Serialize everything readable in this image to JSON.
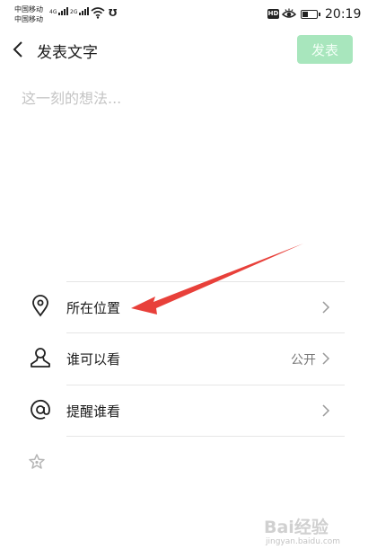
{
  "status_bar": {
    "carrier1": "中国移动",
    "carrier2": "中国移动",
    "sig1_label": "4G",
    "sig2_label": "2G",
    "hd": "HD",
    "time": "20:19",
    "battery_level": 0.45
  },
  "header": {
    "title": "发表文字",
    "publish_label": "发表",
    "publish_color": "#a8e6bd"
  },
  "composer": {
    "placeholder": "这一刻的想法..."
  },
  "options": [
    {
      "label": "所在位置",
      "value": "",
      "icon": "location-pin-icon"
    },
    {
      "label": "谁可以看",
      "value": "公开",
      "icon": "person-icon"
    },
    {
      "label": "提醒谁看",
      "value": "",
      "icon": "at-sign-icon"
    }
  ],
  "footer_icon": "star-icon",
  "annotation": {
    "arrow_color": "#e8403a"
  },
  "watermark": {
    "brand": "Bai经验",
    "url": "jingyan.baidu.com"
  }
}
